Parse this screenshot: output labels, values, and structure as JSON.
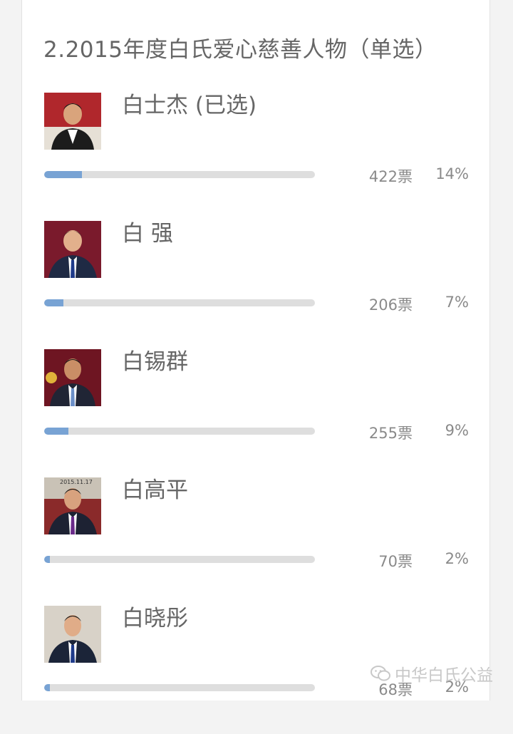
{
  "poll": {
    "title": "2.2015年度白氏爱心慈善人物（单选）",
    "options": [
      {
        "name": "白士杰 (已选)",
        "votes": "422票",
        "percent": "14%",
        "fill": 0.14,
        "avatar_bg": "#b0272c",
        "avatar_tie": "#ffffff"
      },
      {
        "name": "白 强",
        "votes": "206票",
        "percent": "7%",
        "fill": 0.07,
        "avatar_bg": "#7a1a2c",
        "avatar_tie": "#1e3a8a"
      },
      {
        "name": "白锡群",
        "votes": "255票",
        "percent": "9%",
        "fill": 0.09,
        "avatar_bg": "#6e1522",
        "avatar_tie": "#6b8fc8"
      },
      {
        "name": "白高平",
        "votes": "70票",
        "percent": "2%",
        "fill": 0.02,
        "avatar_bg": "#c9c2b6",
        "avatar_tie": "#6a2a8a",
        "photo_date": "2015.11.17"
      },
      {
        "name": "白晓彤",
        "votes": "68票",
        "percent": "2%",
        "fill": 0.02,
        "avatar_bg": "#d8d2c8",
        "avatar_tie": "#1e3a8a"
      }
    ]
  },
  "watermark": {
    "text": "中华白氏公益",
    "icon": "wechat-icon"
  },
  "colors": {
    "bar_fill": "#78a3d4",
    "bar_track": "#dedede",
    "text": "#666666",
    "count_text": "#8a8a8a"
  }
}
